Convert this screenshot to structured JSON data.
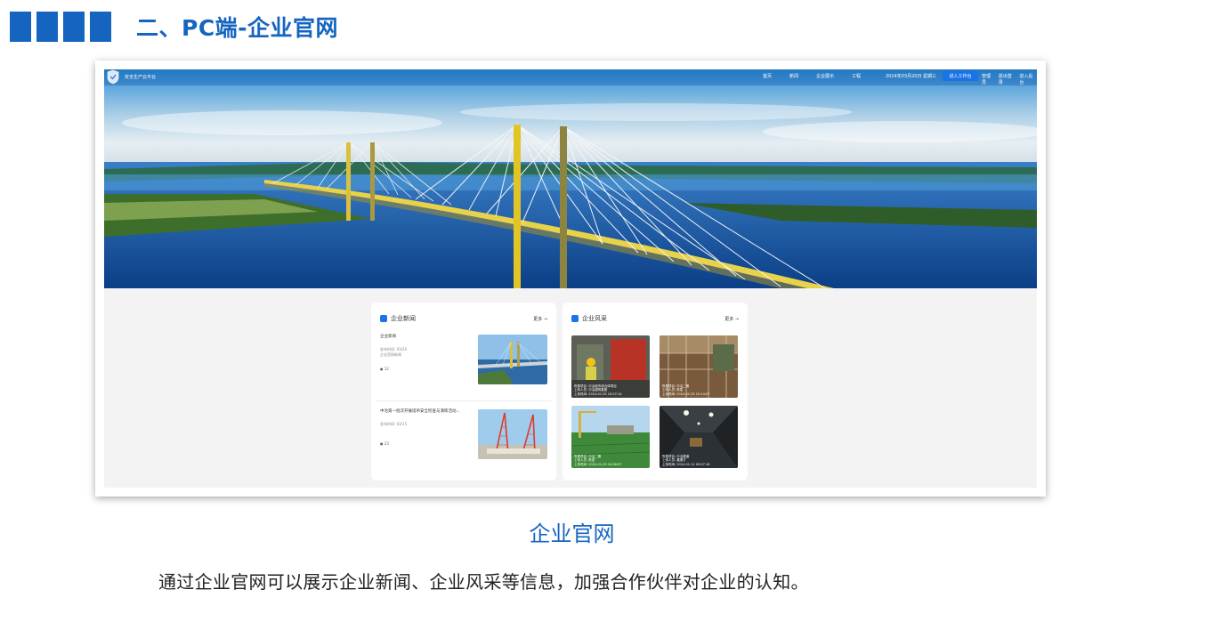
{
  "header": {
    "title": "二、PC端-企业官网"
  },
  "site": {
    "nav": {
      "site_name": "安全生产云平台",
      "items": [
        "首页",
        "新闻",
        "企业展示",
        "工程"
      ],
      "date": "2024年03月20日 星期三",
      "enter_button": "进入工作台",
      "user_items": [
        "管理员",
        "退出登录",
        "进入后台"
      ]
    },
    "news_card": {
      "title": "企业新闻",
      "more": "更多 →",
      "items": [
        {
          "title": "企业新闻",
          "meta_line1": "发布时间: 03/20",
          "meta_line2": "企业官网新闻",
          "views": "● 12"
        },
        {
          "title": "中冶第一批次开展塔吊安全检查与演练活动...",
          "meta_line1": "发布时间: 03/15",
          "meta_line2": "",
          "views": "● 23"
        }
      ]
    },
    "gallery_card": {
      "title": "企业风采",
      "more": "更多 →",
      "items": [
        {
          "line1": "所属项目: 中冶城市综合体项目",
          "line2": "上传人员: 中冶建筑集团",
          "line3": "上传时间: 2024-01-25 10:07:14"
        },
        {
          "line1": "所属项目: 中冶二期",
          "line2": "上传人员: 陈斌",
          "line3": "上传时间: 2024-01-25 10:14:07"
        },
        {
          "line1": "所属项目: 中冶二期",
          "line2": "上传人员: 陈斌",
          "line3": "上传时间: 2024-01-25 10:06:07"
        },
        {
          "line1": "所属项目: 中冶隧道",
          "line2": "上传人员: 董德才",
          "line3": "上传时间: 2024-01-12 09:07:18"
        }
      ]
    }
  },
  "caption": "企业官网",
  "description": "通过企业官网可以展示企业新闻、企业风采等信息，加强合作伙伴对企业的认知。",
  "colors": {
    "accent": "#1565c0",
    "button": "#1a73e8"
  }
}
